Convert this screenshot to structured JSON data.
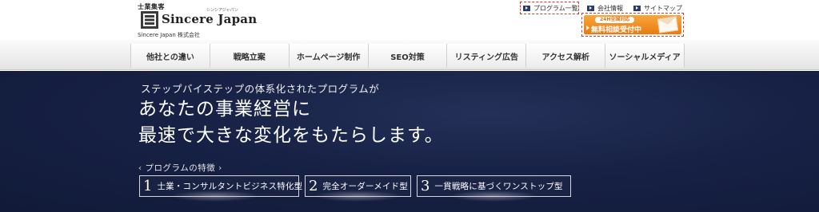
{
  "header": {
    "logo_tagline": "士業集客",
    "logo_ruby": "シンシアジャパン",
    "logo_name": "Sincere Japan",
    "company_name": "Sincere Japan 株式会社",
    "top_links": {
      "program_list": "プログラム一覧",
      "company_info": "会社情報",
      "sitemap": "サイトマップ"
    },
    "cta": {
      "badge": "24H全国対応",
      "label": "無料相談受付中"
    }
  },
  "nav": {
    "items": [
      "他社との違い",
      "戦略立案",
      "ホームページ制作",
      "SEO対策",
      "リスティング広告",
      "アクセス解析",
      "ソーシャルメディア"
    ]
  },
  "hero": {
    "lead": "ステップバイステップの体系化されたプログラムが",
    "headline_line1": "あなたの事業経営に",
    "headline_line2": "最速で大きな変化をもたらします。",
    "features_label": "‹ プログラムの特徴 ›",
    "features": [
      {
        "num": "1",
        "text": "士業・コンサルタントビジネス特化型"
      },
      {
        "num": "2",
        "text": "完全オーダーメイド型"
      },
      {
        "num": "3",
        "text": "一貫戦略に基づくワンストップ型"
      }
    ]
  },
  "colors": {
    "hero_bg": "#172145",
    "cta_orange": "#ea7a12",
    "highlight_border": "#d63a2a",
    "bullet_navy": "#2b3e6a"
  }
}
